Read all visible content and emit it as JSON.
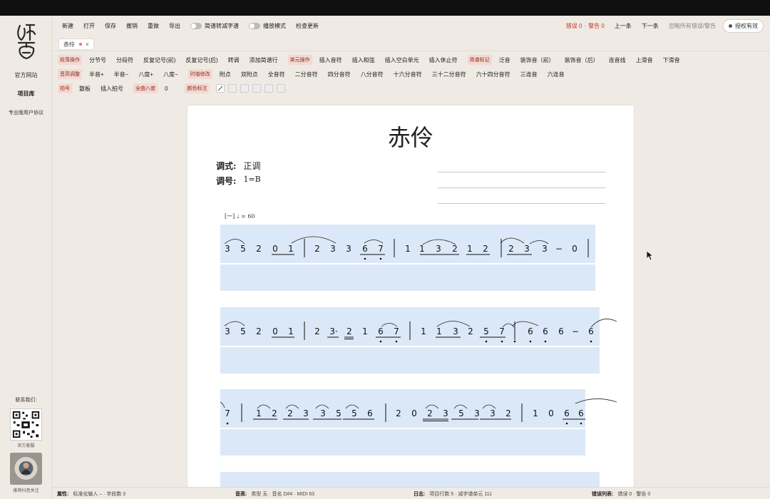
{
  "sidebar": {
    "logo": "如音",
    "links": [
      "官方网站",
      "项目库",
      "专业版用户协议"
    ],
    "contact_label": "联系我们:",
    "qr_caption": "官方客服",
    "avatar_caption": "推荐抖音关注"
  },
  "menu": {
    "items": [
      "新建",
      "打开",
      "保存",
      "撤销",
      "重做",
      "导出"
    ],
    "toggle1": "简谱转减字谱",
    "toggle2": "播放模式",
    "check_update": "检查更新",
    "errors": "错误 0",
    "warnings": "警告 0",
    "sep": "·",
    "prev": "上一条",
    "next": "下一条",
    "ignore": "忽略所有错误/警告",
    "license": "授权有效"
  },
  "tab": {
    "title": "赤伶",
    "close": "×"
  },
  "toolbar": {
    "row1": {
      "g1": "段落操作",
      "g1_items": [
        "分节号",
        "分段符",
        "反复记号(前)",
        "反复记号(后)",
        "转调",
        "添加简谱行"
      ],
      "g2": "单元操作",
      "g2_items": [
        "插入音符",
        "插入和弦",
        "插入空白单元",
        "插入休止符"
      ],
      "g3": "简谱标记",
      "g3_items": [
        "泛音",
        "装饰音（前）",
        "装饰音（后）",
        "连音线",
        "上滑音",
        "下滑音"
      ]
    },
    "row2": {
      "g1": "音高调整",
      "g1_items": [
        "半音+",
        "半音−",
        "八度+",
        "八度−"
      ],
      "g2": "时值修改",
      "g2_items": [
        "附点",
        "双附点",
        "全音符",
        "二分音符",
        "四分音符",
        "八分音符",
        "十六分音符",
        "三十二分音符",
        "六十四分音符",
        "三连音",
        "六连音"
      ]
    },
    "row3": {
      "g1": "拍号",
      "g1_items": [
        "散板",
        "插入拍号"
      ],
      "g2": "全曲八度",
      "octave_value": "0",
      "g3": "颜色标注",
      "pen_icon": "pen-icon"
    }
  },
  "score": {
    "title": "赤伶",
    "mode_label": "调式:",
    "mode_value": "正调",
    "key_label": "调号:",
    "key_value": "1=B",
    "tempo": "[一] ♩ = 60",
    "systems": [
      {
        "notes": [
          "3",
          "5",
          "2",
          "0",
          "1",
          "|",
          "2",
          "3",
          "3",
          "6",
          "7",
          "|",
          "1",
          "1",
          "3",
          "2",
          "1",
          "2",
          "|",
          "2",
          "3",
          "3",
          "−",
          "0",
          "|"
        ]
      },
      {
        "notes": [
          "3",
          "5",
          "2",
          "0",
          "1",
          "|",
          "2",
          "3·",
          "2",
          "1",
          "6",
          "7",
          "|",
          "1",
          "1",
          "3",
          "2",
          "5",
          "7",
          "|",
          "6",
          "6",
          "6",
          "−",
          "6"
        ]
      },
      {
        "notes": [
          "7",
          "|",
          "1",
          "2",
          "2",
          "3",
          "3",
          "5",
          "5",
          "6",
          "|",
          "2",
          "0",
          "2",
          "3",
          "5",
          "3",
          "3",
          "2",
          "|",
          "1",
          "0",
          "6",
          "6"
        ]
      }
    ]
  },
  "status": {
    "attr_label": "属性:",
    "attr_value": "标准化输入 – · 字段数 0",
    "pitch_label": "音高:",
    "pitch_value": "类型 无 · 音名 D#4 · MIDI 63",
    "log_label": "日志:",
    "log_value": "项目行数 5 · 减字谱单元 111",
    "errlist_label": "错误列表:",
    "errlist_value": "错误 0 · 警告 0"
  },
  "colors": {
    "accent_red": "#c0392b",
    "group_tag_bg": "#f3d9d2",
    "system_bg": "#dbe8f7"
  }
}
